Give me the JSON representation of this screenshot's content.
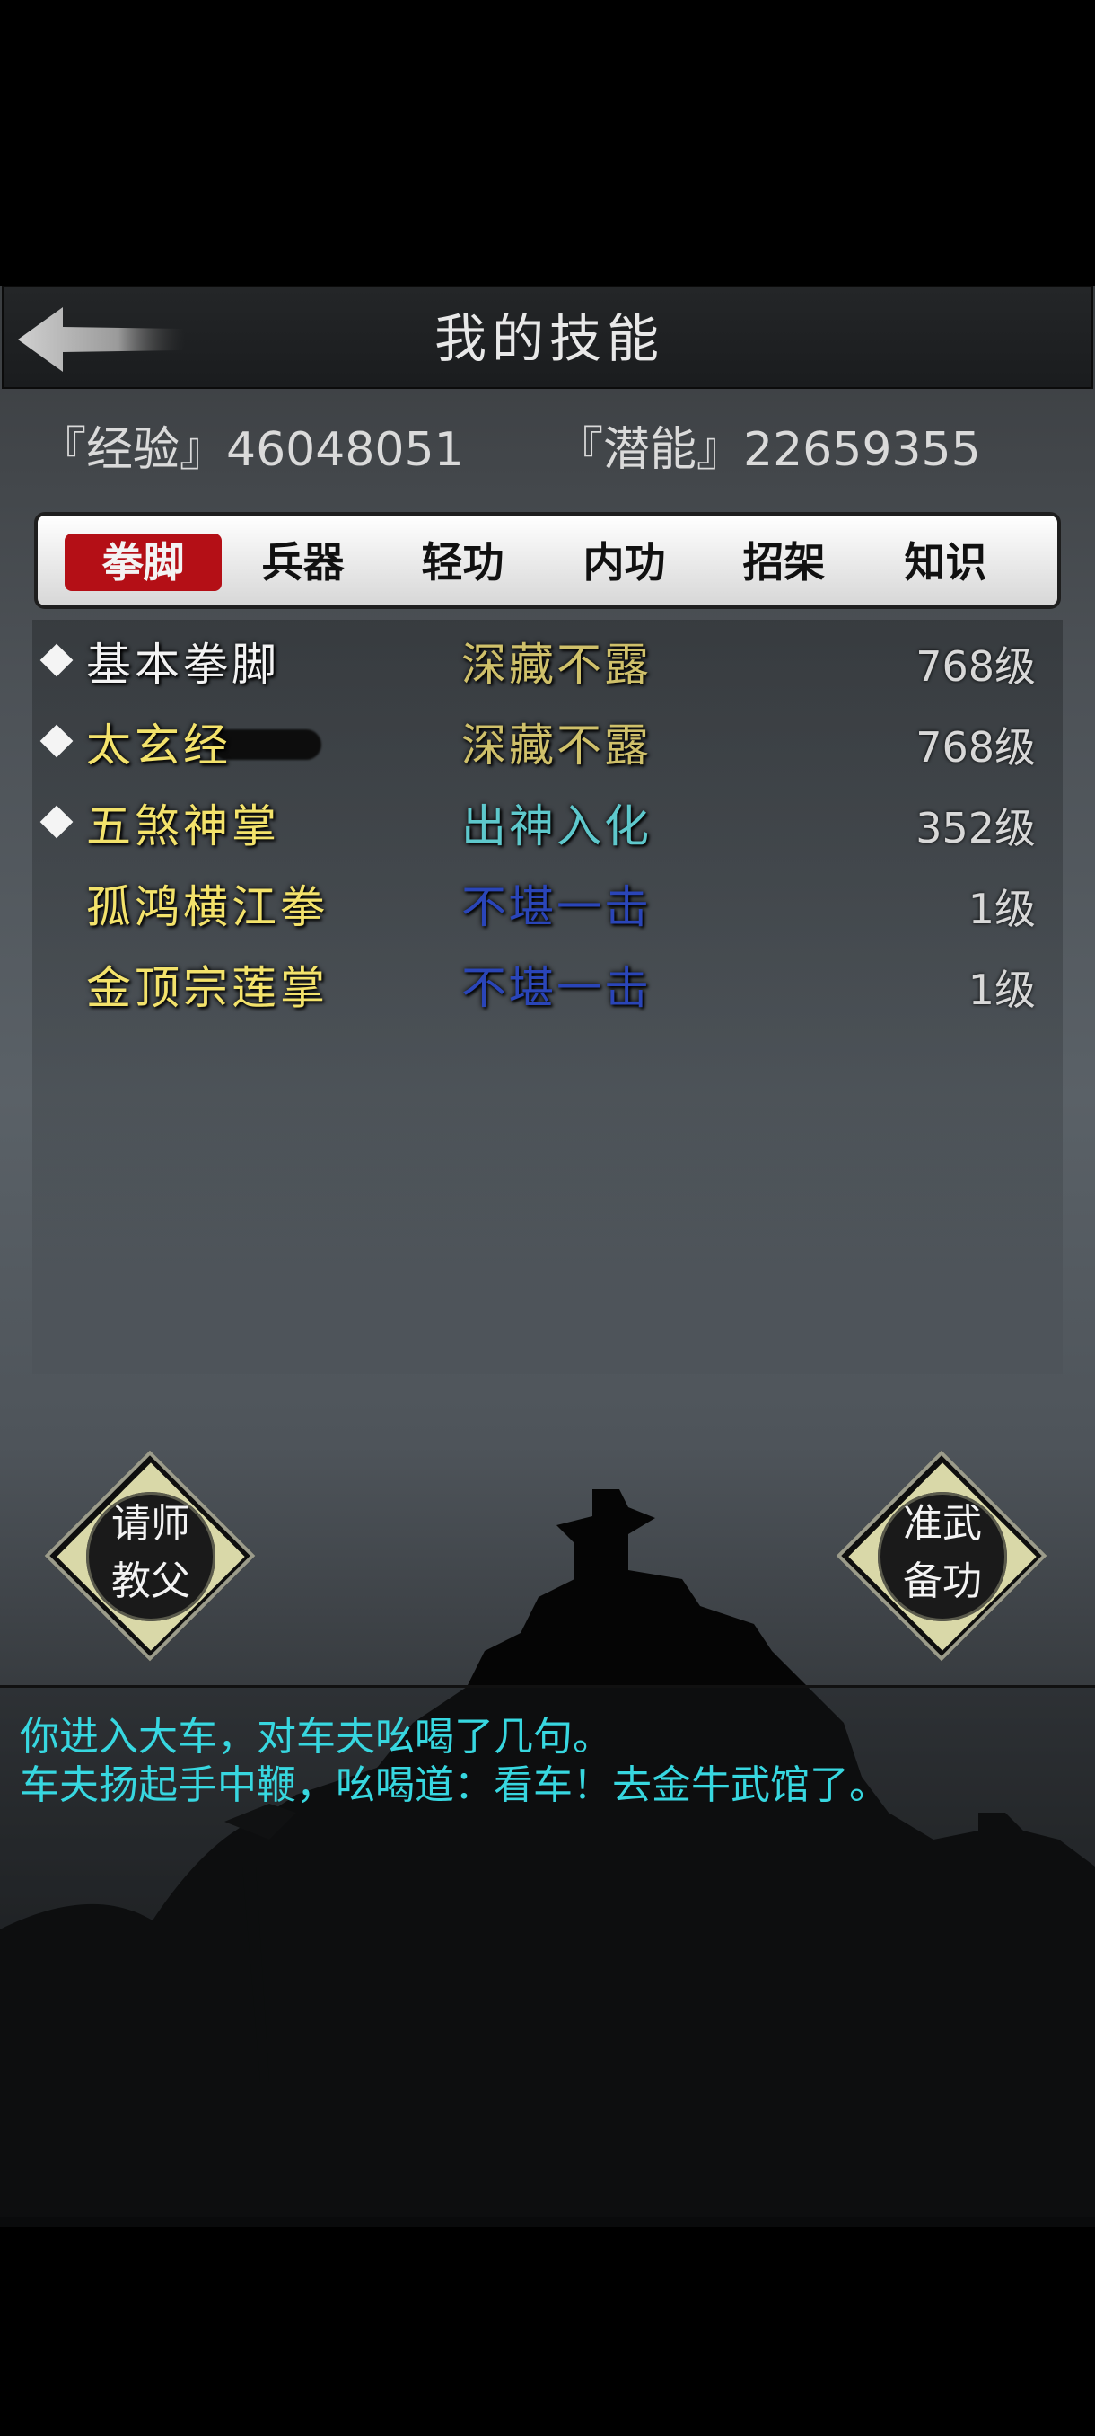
{
  "header": {
    "title": "我的技能"
  },
  "stats": {
    "experience": "『经验』46048051",
    "potential": "『潜能』22659355"
  },
  "tabs": [
    {
      "label": "拳脚",
      "active": true
    },
    {
      "label": "兵器",
      "active": false
    },
    {
      "label": "轻功",
      "active": false
    },
    {
      "label": "内功",
      "active": false
    },
    {
      "label": "招架",
      "active": false
    },
    {
      "label": "知识",
      "active": false
    }
  ],
  "skills": [
    {
      "name": "基本拳脚",
      "level_text": "深藏不露",
      "grade": "768级",
      "marked": true,
      "name_color": "#f2f2f2",
      "level_color": "#cfc06a"
    },
    {
      "name": "太玄经",
      "level_text": "深藏不露",
      "grade": "768级",
      "marked": true,
      "name_color": "#f3e26b",
      "level_color": "#cfc06a"
    },
    {
      "name": "五煞神掌",
      "level_text": "出神入化",
      "grade": "352级",
      "marked": true,
      "name_color": "#f3e26b",
      "level_color": "#5ec8cc"
    },
    {
      "name": "孤鸿横江拳",
      "level_text": "不堪一击",
      "grade": "1级",
      "marked": false,
      "name_color": "#f3e26b",
      "level_color": "#2a45b8"
    },
    {
      "name": "金顶宗莲掌",
      "level_text": "不堪一击",
      "grade": "1级",
      "marked": false,
      "name_color": "#f3e26b",
      "level_color": "#2a45b8"
    }
  ],
  "actions": {
    "ask_master": {
      "line1": "请师",
      "line2": "教父"
    },
    "prepare": {
      "line1": "准武",
      "line2": "备功"
    }
  },
  "log": [
    "你进入大车，对车夫吆喝了几句。",
    "车夫扬起手中鞭，吆喝道：看车！去金牛武馆了。"
  ],
  "colors": {
    "tab_active": "#b40f16",
    "log_text": "#37d7e0",
    "skill_gold": "#f3e26b"
  }
}
